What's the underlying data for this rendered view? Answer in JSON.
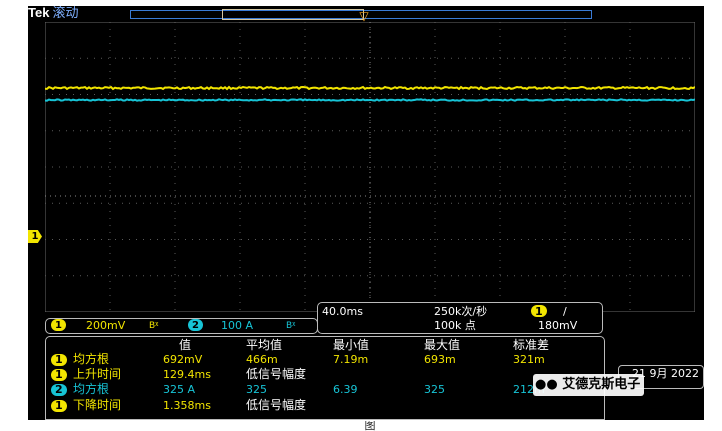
{
  "app": {
    "brand": "Tek",
    "mode": "滚动"
  },
  "channel_info": {
    "ch1": {
      "number": "1",
      "scale": "200mV",
      "bw_symbol": "Bᵡ"
    },
    "ch2": {
      "number": "2",
      "scale": "100 A",
      "bw_symbol": "Bᵡ"
    }
  },
  "acquisition": {
    "time_per_div": "40.0ms",
    "sample_rate": "250k次/秒",
    "record_length": "100k 点",
    "trigger_channel": "1",
    "trigger_slope": "/",
    "trigger_level": "180mV"
  },
  "measurements": {
    "headers": [
      "值",
      "平均值",
      "最小值",
      "最大值",
      "标准差"
    ],
    "rows": [
      {
        "channel": "1",
        "name": "均方根",
        "value": "692mV",
        "mean": "466m",
        "min": "7.19m",
        "max": "693m",
        "std": "321m"
      },
      {
        "channel": "1",
        "name": "上升时间",
        "value": "129.4ms",
        "mean": "低信号幅度",
        "min": "",
        "max": "",
        "std": ""
      },
      {
        "channel": "2",
        "name": "均方根",
        "value": "325 A",
        "mean": "325",
        "min": "6.39",
        "max": "325",
        "std": "212m"
      },
      {
        "channel": "1",
        "name": "下降时间",
        "value": "1.358ms",
        "mean": "低信号幅度",
        "min": "",
        "max": "",
        "std": ""
      }
    ]
  },
  "date": {
    "day_month": "21 9月 2022"
  },
  "watermark": {
    "text": "艾德克斯电子",
    "icon": "wechat-icon"
  },
  "caption": "图",
  "colors": {
    "ch1": "#f2e500",
    "ch2": "#17c4d6",
    "grid": "#5a5a5a"
  }
}
